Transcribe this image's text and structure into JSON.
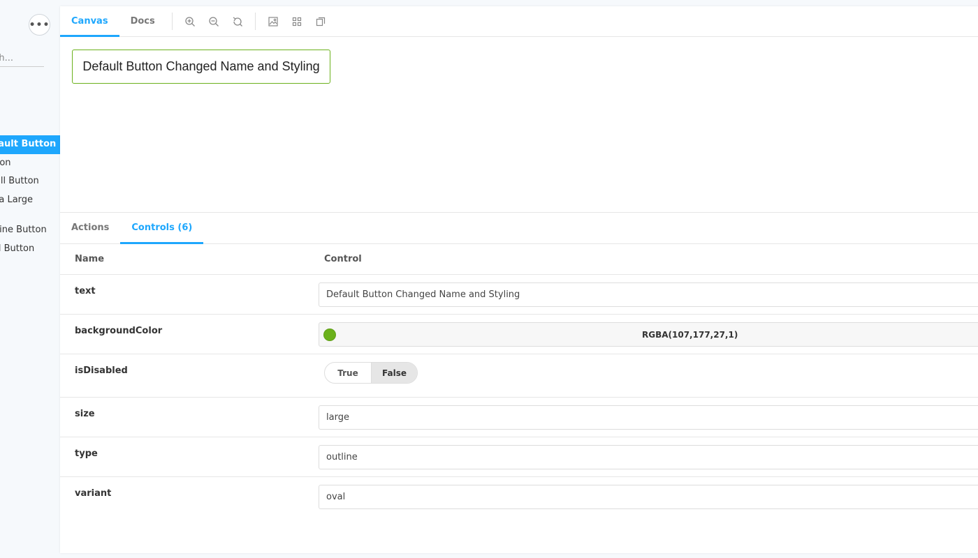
{
  "sidebar": {
    "more_label": "•••",
    "search_placeholder": "Search...",
    "items": [
      {
        "label": "Default Button"
      },
      {
        "label": "Button"
      },
      {
        "label": "Small Button"
      },
      {
        "label": "Extra Large"
      },
      {
        "label": "Outline Button"
      },
      {
        "label": "Oval Button"
      }
    ]
  },
  "toolbar": {
    "tabs": [
      {
        "label": "Canvas"
      },
      {
        "label": "Docs"
      }
    ],
    "tools": [
      "zoom-in-icon",
      "zoom-out-icon",
      "reset-zoom-icon",
      "background-icon",
      "grid-icon",
      "viewport-icon"
    ]
  },
  "canvas": {
    "preview_button_label": "Default Button Changed Name and Styling"
  },
  "addons": {
    "tabs": [
      {
        "label": "Actions"
      },
      {
        "label": "Controls (6)"
      }
    ]
  },
  "controls": {
    "header_name": "Name",
    "header_control": "Control",
    "rows": [
      {
        "name": "text",
        "value": "Default Button Changed Name and Styling"
      },
      {
        "name": "backgroundColor",
        "value": "RGBA(107,177,27,1)",
        "color": "#6bb11b"
      },
      {
        "name": "isDisabled",
        "true_label": "True",
        "false_label": "False"
      },
      {
        "name": "size",
        "value": "large"
      },
      {
        "name": "type",
        "value": "outline"
      },
      {
        "name": "variant",
        "value": "oval"
      }
    ]
  },
  "colors": {
    "accent": "#1ea7fd",
    "preview_border": "#6bb11b"
  }
}
